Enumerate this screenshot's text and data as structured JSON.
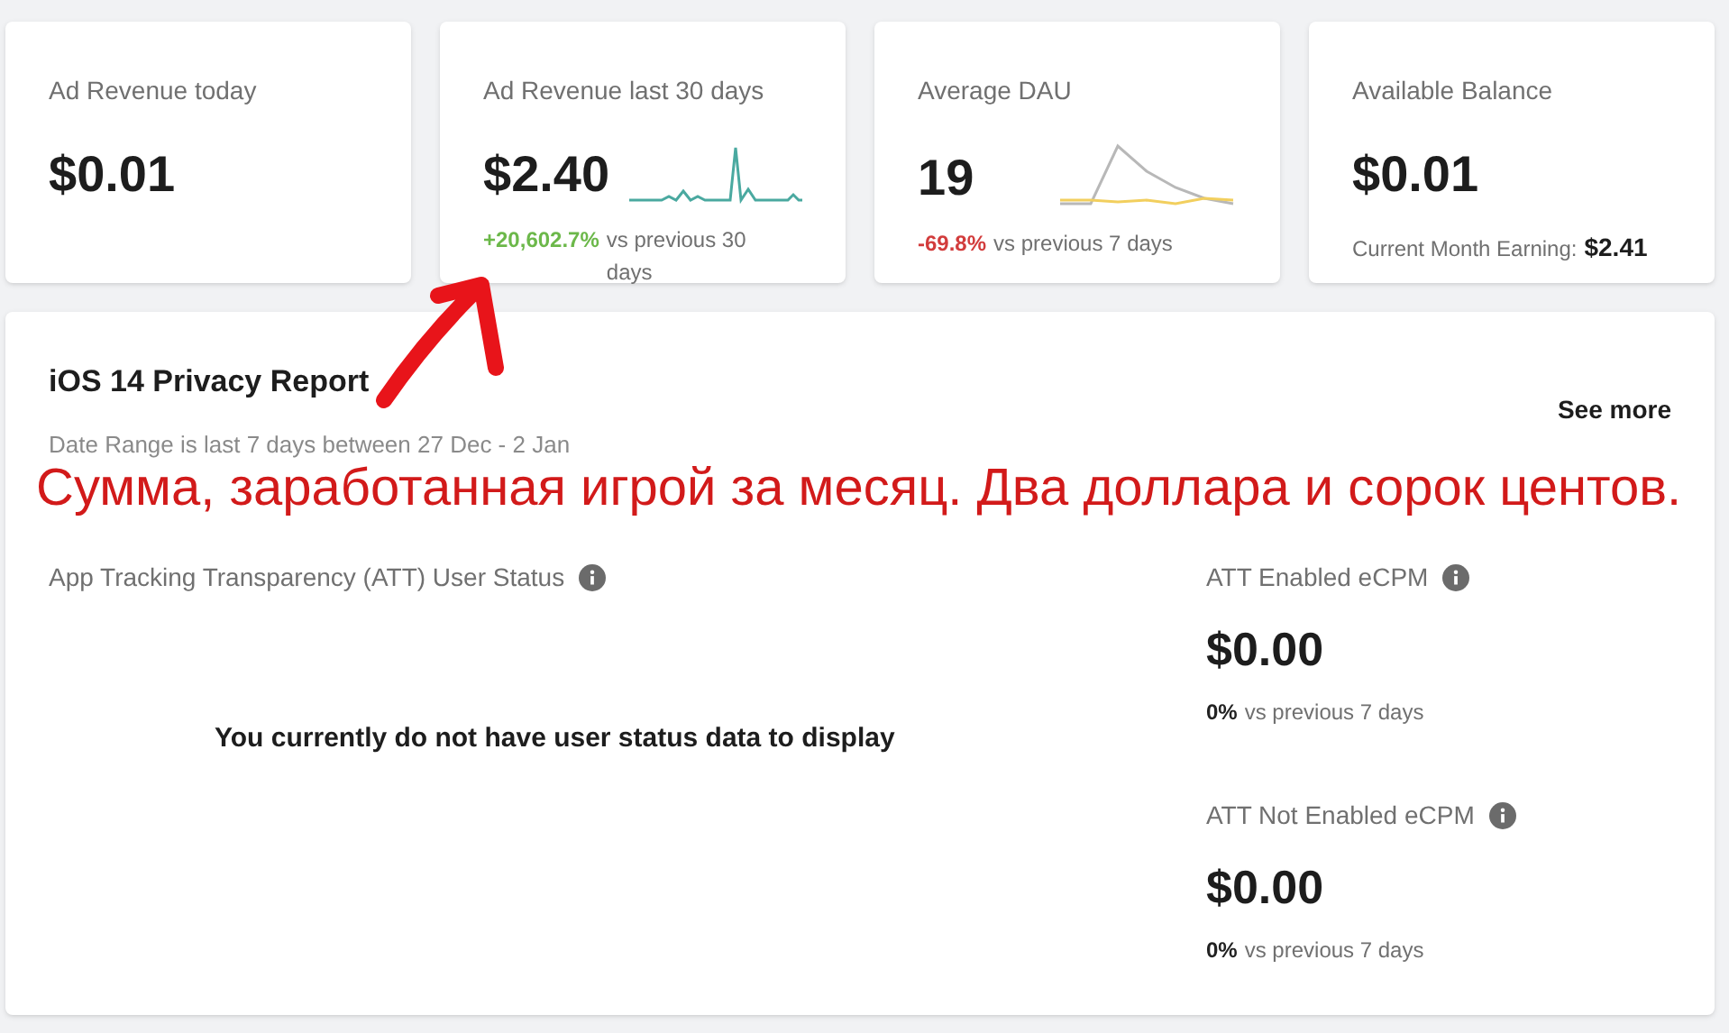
{
  "stat_cards": [
    {
      "kind": "plain",
      "title": "Ad Revenue today",
      "value": "$0.01"
    },
    {
      "kind": "revenue_trend",
      "title": "Ad Revenue last 30 days",
      "value": "$2.40",
      "change": "+20,602.7%",
      "color": "#6cb84a",
      "comparison": "vs previous 30 days"
    },
    {
      "kind": "dau_trend",
      "title": "Average DAU",
      "value": "19",
      "change": "-69.8%",
      "color": "#d23c3c",
      "comparison": "vs previous 7 days"
    },
    {
      "kind": "balance",
      "title": "Available Balance",
      "value": "$0.01",
      "note_label": "Current Month Earning:",
      "note_value": "$2.41"
    }
  ],
  "privacy_report": {
    "title": "iOS 14 Privacy Report",
    "subtitle": "Date Range is last 7 days between 27 Dec - 2 Jan",
    "see_more": "See more",
    "att_status": {
      "label": "App Tracking Transparency (ATT) User Status",
      "empty_message": "You currently do not have user status data to display"
    },
    "metrics": [
      {
        "label": "ATT Enabled eCPM",
        "value": "$0.00",
        "change": "0%",
        "color": "#222222",
        "comparison": "vs previous 7 days"
      },
      {
        "label": "ATT Not Enabled eCPM",
        "value": "$0.00",
        "change": "0%",
        "color": "#222222",
        "comparison": "vs previous 7 days"
      }
    ]
  },
  "annotation": {
    "text": "Сумма, заработанная игрой за месяц. Два доллара и сорок центов."
  }
}
